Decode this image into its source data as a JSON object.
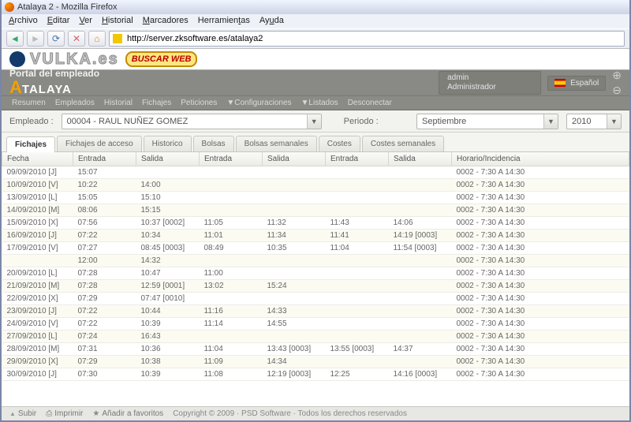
{
  "window": {
    "title": "Atalaya 2 - Mozilla Firefox"
  },
  "menubar": [
    "Archivo",
    "Editar",
    "Ver",
    "Historial",
    "Marcadores",
    "Herramientas",
    "Ayuda"
  ],
  "address": "http://server.zksoftware.es/atalaya2",
  "vulka": "VULKA.es",
  "buscar": "BUSCAR WEB",
  "portal": {
    "sub": "Portal del empleado",
    "brandA": "A",
    "brandRest": "TALAYA"
  },
  "user": {
    "name": "admin",
    "role": "Administrador"
  },
  "lang": "Español",
  "menu2": [
    "Resumen",
    "Empleados",
    "Historial",
    "Fichajes",
    "Peticiones",
    "▼Configuraciones",
    "▼Listados",
    "Desconectar"
  ],
  "filter": {
    "emp_label": "Empleado :",
    "emp_value": "00004 - RAUL NUÑEZ GOMEZ",
    "per_label": "Periodo :",
    "mes": "Septiembre",
    "year": "2010"
  },
  "tabs": [
    "Fichajes",
    "Fichajes de acceso",
    "Historico",
    "Bolsas",
    "Bolsas semanales",
    "Costes",
    "Costes semanales"
  ],
  "headers": [
    "Fecha",
    "Entrada",
    "Salida",
    "Entrada",
    "Salida",
    "Entrada",
    "Salida",
    "Horario/Incidencia"
  ],
  "rows": [
    {
      "d": "09/09/2010 [J]",
      "c": [
        "15:07",
        "",
        "",
        "",
        "",
        ""
      ],
      "h": "0002 - 7:30 A 14:30"
    },
    {
      "d": "10/09/2010 [V]",
      "c": [
        "10:22",
        "14:00",
        "",
        "",
        "",
        ""
      ],
      "h": "0002 - 7:30 A 14:30"
    },
    {
      "d": "13/09/2010 [L]",
      "c": [
        "15:05",
        "15:10",
        "",
        "",
        "",
        ""
      ],
      "h": "0002 - 7:30 A 14:30"
    },
    {
      "d": "14/09/2010 [M]",
      "c": [
        "08:06",
        "15:15",
        "",
        "",
        "",
        ""
      ],
      "h": "0002 - 7:30 A 14:30"
    },
    {
      "d": "15/09/2010 [X]",
      "c": [
        "07:56",
        {
          "t": "10:37 [0002]",
          "b": 1
        },
        "11:05",
        "11:32",
        "11:43",
        "14:06"
      ],
      "h": "0002 - 7:30 A 14:30"
    },
    {
      "d": "16/09/2010 [J]",
      "c": [
        "07:22",
        "10:34",
        "11:01",
        "11:34",
        "11:41",
        {
          "t": "14:19 [0003]",
          "b": 1
        }
      ],
      "h": "0002 - 7:30 A 14:30"
    },
    {
      "d": "17/09/2010 [V]",
      "c": [
        "07:27",
        {
          "t": "08:45 [0003]",
          "b": 1
        },
        "08:49",
        "10:35",
        "11:04",
        {
          "t": "11:54 [0003]",
          "b": 1
        }
      ],
      "h": "0002 - 7:30 A 14:30"
    },
    {
      "d": "",
      "c": [
        "12:00",
        "14:32",
        "",
        "",
        "",
        ""
      ],
      "h": "0002 - 7:30 A 14:30"
    },
    {
      "d": "20/09/2010 [L]",
      "c": [
        "07:28",
        "10:47",
        "11:00",
        "",
        "",
        ""
      ],
      "h": "0002 - 7:30 A 14:30"
    },
    {
      "d": "21/09/2010 [M]",
      "c": [
        "07:28",
        {
          "t": "12:59 [0001]",
          "b": 1
        },
        "13:02",
        "15:24",
        "",
        ""
      ],
      "h": "0002 - 7:30 A 14:30"
    },
    {
      "d": "22/09/2010 [X]",
      "c": [
        "07:29",
        {
          "t": "07:47 [0010]",
          "b": 1
        },
        "",
        "",
        "",
        ""
      ],
      "h": "0002 - 7:30 A 14:30"
    },
    {
      "d": "23/09/2010 [J]",
      "c": [
        "07:22",
        "10:44",
        "11:16",
        "14:33",
        "",
        ""
      ],
      "h": "0002 - 7:30 A 14:30"
    },
    {
      "d": "24/09/2010 [V]",
      "c": [
        "07:22",
        "10:39",
        "11:14",
        "14:55",
        "",
        ""
      ],
      "h": "0002 - 7:30 A 14:30"
    },
    {
      "d": "27/09/2010 [L]",
      "c": [
        "07:24",
        "16:43",
        "",
        "",
        "",
        ""
      ],
      "h": "0002 - 7:30 A 14:30"
    },
    {
      "d": "28/09/2010 [M]",
      "c": [
        "07:31",
        "10:36",
        "11:04",
        {
          "t": "13:43 [0003]",
          "b": 1
        },
        {
          "t": "13:55 [0003]",
          "b": 1
        },
        "14:37"
      ],
      "h": "0002 - 7:30 A 14:30"
    },
    {
      "d": "29/09/2010 [X]",
      "c": [
        "07:29",
        "10:38",
        "11:09",
        "14:34",
        "",
        ""
      ],
      "h": "0002 - 7:30 A 14:30"
    },
    {
      "d": "30/09/2010 [J]",
      "c": [
        "07:30",
        "10:39",
        "11:08",
        {
          "t": "12:19 [0003]",
          "b": 1
        },
        "12:25",
        {
          "t": "14:16 [0003]",
          "b": 1
        }
      ],
      "h": "0002 - 7:30 A 14:30"
    }
  ],
  "footer": {
    "subir": "Subir",
    "imprimir": "Imprimir",
    "fav": "Añadir a favoritos",
    "copy": "Copyright © 2009 · PSD Software · Todos los derechos reservados"
  }
}
